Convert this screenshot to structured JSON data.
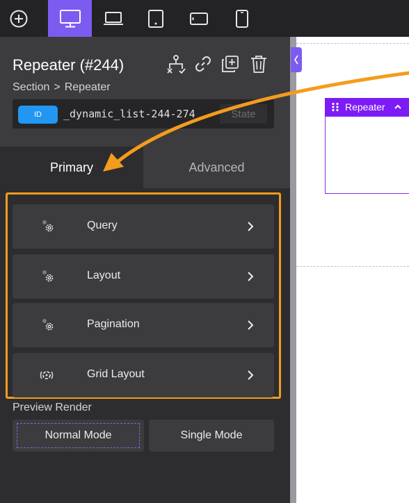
{
  "toolbar": {
    "items": [
      {
        "name": "add-element",
        "icon": "plus-circle-icon"
      },
      {
        "name": "desktop",
        "icon": "desktop-icon",
        "active": true
      },
      {
        "name": "laptop",
        "icon": "laptop-icon"
      },
      {
        "name": "tablet",
        "icon": "tablet-icon"
      },
      {
        "name": "tablet-landscape",
        "icon": "tablet-landscape-icon"
      },
      {
        "name": "phone",
        "icon": "phone-icon"
      }
    ],
    "active_color": "#7c5cf0"
  },
  "panel": {
    "title": "Repeater (#244)",
    "breadcrumb": {
      "parent": "Section",
      "separator": ">",
      "current": "Repeater"
    },
    "id_badge": "ID",
    "id_value": "_dynamic_list-244-274",
    "state_button": "State",
    "header_icons": [
      "structure-icon",
      "link-icon",
      "duplicate-icon",
      "trash-icon"
    ]
  },
  "tabs": {
    "primary": "Primary",
    "advanced": "Advanced"
  },
  "accordion": [
    {
      "label": "Query",
      "icon": "gear-icon"
    },
    {
      "label": "Layout",
      "icon": "gear-icon"
    },
    {
      "label": "Pagination",
      "icon": "gear-icon"
    },
    {
      "label": "Grid Layout",
      "icon": "grid-spinner-icon"
    }
  ],
  "preview": {
    "label": "Preview Render",
    "normal_mode": "Normal Mode",
    "single_mode": "Single Mode"
  },
  "canvas": {
    "repeater_label": "Repeater",
    "accent": "#7c1bf5"
  },
  "colors": {
    "highlight_box": "#f39c1d",
    "annotation_arrow": "#f39c1d",
    "id_badge": "#2196f3"
  }
}
